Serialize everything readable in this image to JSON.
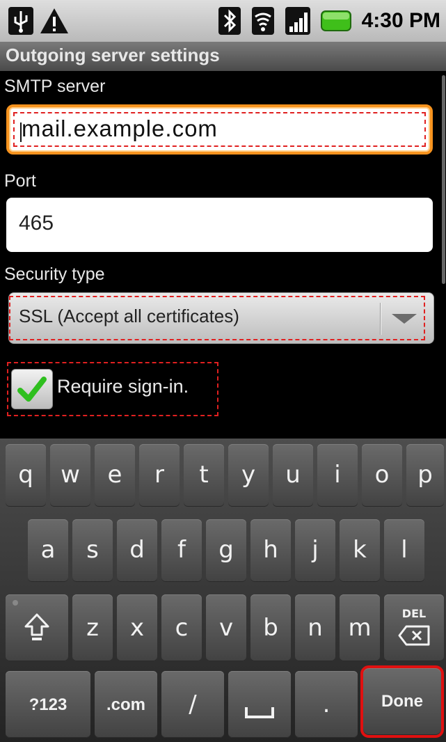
{
  "status_bar": {
    "icons": [
      "usb-icon",
      "warning-icon",
      "bluetooth-icon",
      "wifi-icon",
      "signal-icon",
      "battery-icon"
    ],
    "time": "4:30 PM"
  },
  "title_bar": {
    "title": "Outgoing server settings"
  },
  "form": {
    "smtp_label": "SMTP server",
    "smtp_value": "mail.example.com",
    "port_label": "Port",
    "port_value": "465",
    "security_label": "Security type",
    "security_value": "SSL (Accept all certificates)",
    "require_signin_label": "Require sign-in.",
    "require_signin_checked": true
  },
  "keyboard": {
    "row1": [
      "q",
      "w",
      "e",
      "r",
      "t",
      "y",
      "u",
      "i",
      "o",
      "p"
    ],
    "row2": [
      "a",
      "s",
      "d",
      "f",
      "g",
      "h",
      "j",
      "k",
      "l"
    ],
    "row3": [
      "z",
      "x",
      "c",
      "v",
      "b",
      "n",
      "m"
    ],
    "del_label": "DEL",
    "symbols_label": "?123",
    "dotcom_label": ".com",
    "slash_label": "/",
    "period_label": ".",
    "done_label": "Done"
  },
  "colors": {
    "focus_orange": "#f7931e",
    "highlight_red": "#e02020",
    "check_green": "#2fbf1f",
    "battery_green": "#3fbf1a"
  }
}
